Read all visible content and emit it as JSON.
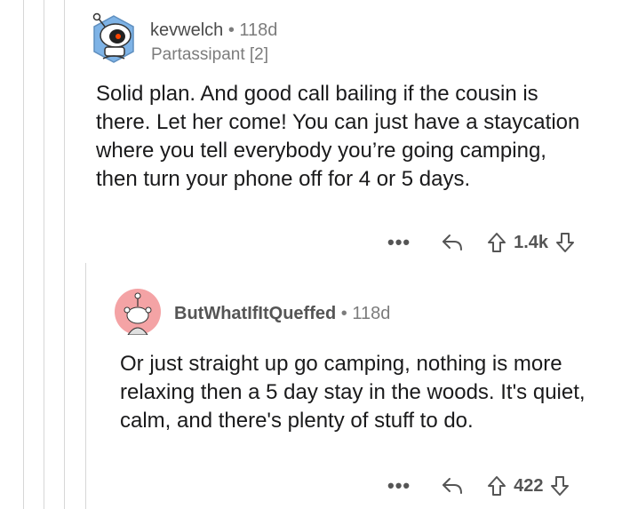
{
  "comments": [
    {
      "username": "kevwelch",
      "separator": "•",
      "age": "118d",
      "flair": "Partassipant [2]",
      "body": "Solid plan. And good call bailing if the cousin is there. Let her come! You can just have a staycation where you tell everybody you’re going camping, then turn your phone off for 4 or 5 days.",
      "more_label": "•••",
      "score": "1.4k"
    },
    {
      "username": "ButWhatIfItQueffed",
      "separator": "•",
      "age": "118d",
      "body": "Or just straight up go camping, nothing is more relaxing then a 5 day stay in the woods. It's quiet, calm, and there's plenty of stuff to do.",
      "more_label": "•••",
      "score": "422"
    }
  ],
  "colors": {
    "thread_line": "#d7d7d7",
    "avatar1_bg": "#7eb3e6",
    "avatar2_bg": "#f4a3a5",
    "text": "#1a1a1b",
    "muted": "#7c7c7c"
  }
}
